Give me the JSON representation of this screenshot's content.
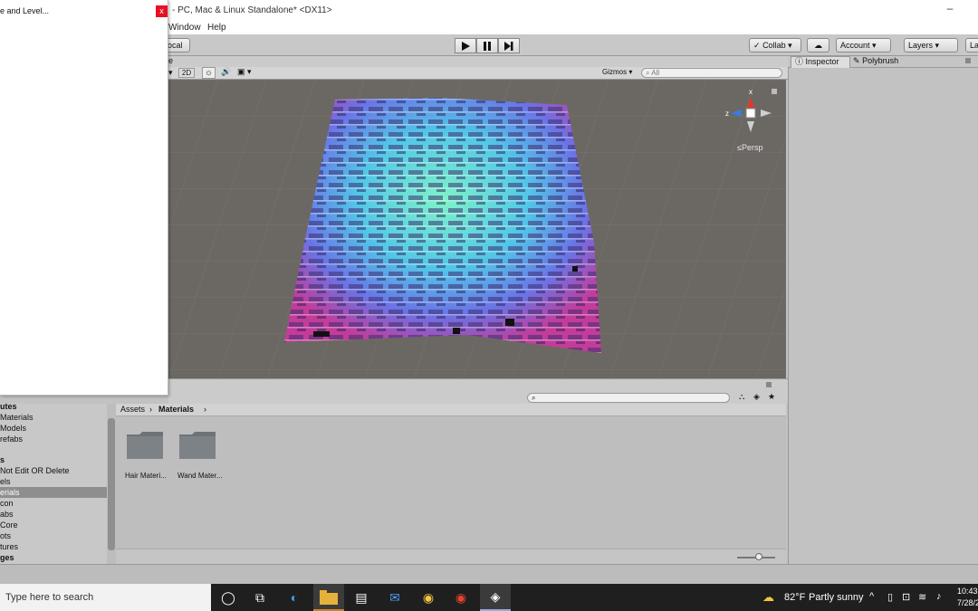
{
  "window": {
    "title": "- PC, Mac & Linux Standalone* <DX11>",
    "minimize": "–"
  },
  "menu": {
    "items": [
      "Window",
      "Help"
    ]
  },
  "toolbar": {
    "local_label": "ocal",
    "collab_label": "Collab ▾",
    "account_label": "Account ▾",
    "layers_label": "Layers ▾",
    "layout_label": "La"
  },
  "scene": {
    "tab_fragment": "e",
    "btn_2d": "2D",
    "gizmos_label": "Gizmos ▾",
    "search_placeholder": "All",
    "persp_label": "Persp",
    "axis_z": "z",
    "axis_x": "x"
  },
  "inspector": {
    "tab_inspector": "Inspector",
    "tab_polybrush": "Polybrush"
  },
  "popup": {
    "title": "e and Level...",
    "close": "x"
  },
  "folder_tree": {
    "items": [
      {
        "label": "utes",
        "bold": true
      },
      {
        "label": "Materials",
        "bold": false
      },
      {
        "label": "Models",
        "bold": false
      },
      {
        "label": "refabs",
        "bold": false
      },
      {
        "label": "",
        "bold": false
      },
      {
        "label": "s",
        "bold": true
      },
      {
        "label": "Not Edit OR Delete",
        "bold": false
      },
      {
        "label": "els",
        "bold": false
      },
      {
        "label": "erials",
        "bold": false,
        "selected": true
      },
      {
        "label": "con",
        "bold": false
      },
      {
        "label": "abs",
        "bold": false
      },
      {
        "label": "Core",
        "bold": false
      },
      {
        "label": "ots",
        "bold": false
      },
      {
        "label": "tures",
        "bold": false
      },
      {
        "label": "ges",
        "bold": true
      }
    ]
  },
  "project": {
    "breadcrumb_root": "Assets",
    "breadcrumb_current": "Materials",
    "folders": [
      {
        "label": "Hair Materi..."
      },
      {
        "label": "Wand Mater..."
      }
    ]
  },
  "taskbar": {
    "search_placeholder": "Type here to search",
    "weather_temp": "82°F",
    "weather_text": "Partly sunny",
    "time": "10:43",
    "date": "7/28/2"
  }
}
